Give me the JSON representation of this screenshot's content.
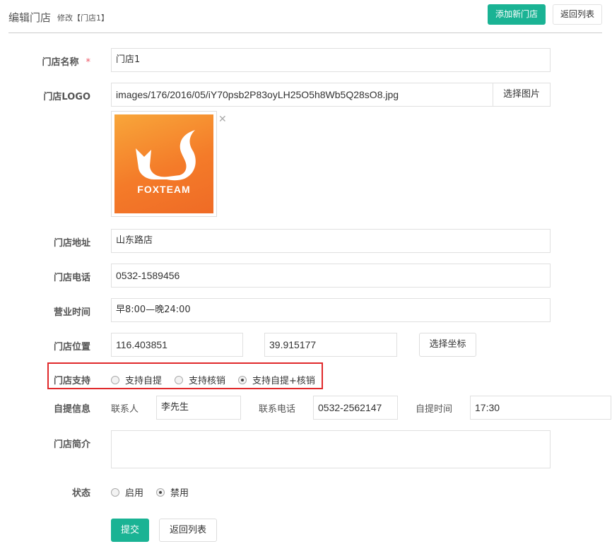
{
  "header": {
    "title": "编辑门店",
    "subtitle": "修改【门店1】",
    "add_button": "添加新门店",
    "back_button": "返回列表"
  },
  "form": {
    "name": {
      "label": "门店名称",
      "required_mark": "*",
      "value": "门店1"
    },
    "logo": {
      "label": "门店LOGO",
      "value": "images/176/2016/05/iY70psb2P83oyLH25O5h8Wb5Q28sO8.jpg",
      "choose_button": "选择图片",
      "preview_text": "FOXTEAM",
      "remove_glyph": "✕"
    },
    "address": {
      "label": "门店地址",
      "value": "山东路店"
    },
    "phone": {
      "label": "门店电话",
      "value": "0532-1589456"
    },
    "hours": {
      "label": "营业时间",
      "value": "早8:00—晚24:00"
    },
    "location": {
      "label": "门店位置",
      "lng": "116.403851",
      "lat": "39.915177",
      "choose_button": "选择坐标"
    },
    "support": {
      "label": "门店支持",
      "options": [
        "支持自提",
        "支持核销",
        "支持自提+核销"
      ],
      "selected": "支持自提+核销"
    },
    "pickup": {
      "label": "自提信息",
      "contact_label": "联系人",
      "contact_value": "李先生",
      "phone_label": "联系电话",
      "phone_value": "0532-2562147",
      "time_label": "自提时间",
      "time_value": "17:30"
    },
    "intro": {
      "label": "门店简介",
      "value": ""
    },
    "status": {
      "label": "状态",
      "options": [
        "启用",
        "禁用"
      ],
      "selected": "禁用"
    }
  },
  "footer": {
    "submit_button": "提交",
    "back_button": "返回列表"
  },
  "colors": {
    "primary": "#1ab394",
    "highlight_border": "#e0292b",
    "logo_orange": "#f47b29"
  }
}
